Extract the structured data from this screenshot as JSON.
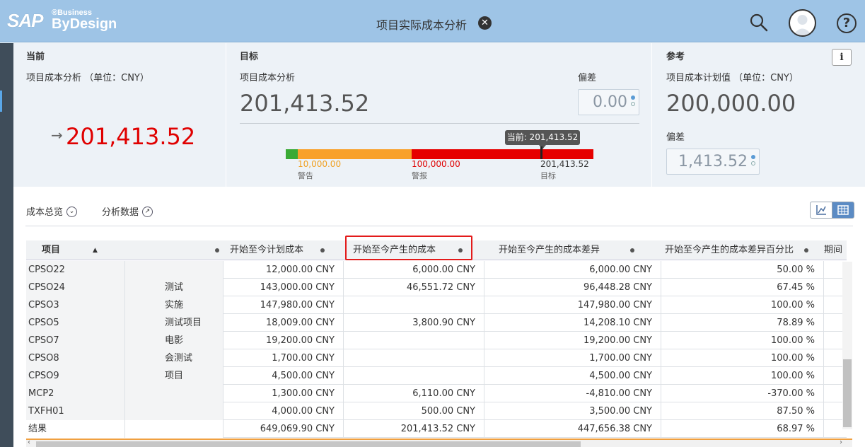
{
  "header": {
    "logo_sap": "SAP",
    "logo_business": "®Business",
    "logo_bydesign": "ByDesign",
    "title": "项目实际成本分析"
  },
  "current": {
    "section": "当前",
    "label": "项目成本分析 （单位：CNY）",
    "value": "201,413.52"
  },
  "target": {
    "section": "目标",
    "label": "项目成本分析",
    "value": "201,413.52",
    "deviation_label": "偏差",
    "deviation_value": "0.00",
    "tooltip": "当前: 201,413.52",
    "ticks": [
      {
        "value": "10,000.00",
        "label": "警告",
        "color": "#f0a020"
      },
      {
        "value": "100,000.00",
        "label": "警报",
        "color": "#e00000"
      },
      {
        "value": "201,413.52",
        "label": "目标",
        "color": "#333333"
      }
    ],
    "bar_colors": {
      "ok": "#3aaa35",
      "warn": "#f8a12a",
      "alert": "#e60000"
    }
  },
  "reference": {
    "section": "参考",
    "label": "项目成本计划值 （单位：CNY）",
    "value": "200,000.00",
    "deviation_label": "偏差",
    "deviation_value": "1,413.52"
  },
  "tabs": {
    "overview": "成本总览",
    "analysis": "分析数据"
  },
  "table": {
    "headers": [
      "项目",
      "开始至今计划成本",
      "开始至今产生的成本",
      "开始至今产生的成本差异",
      "开始至今产生的成本差异百分比",
      "期间"
    ],
    "rows": [
      {
        "id": "CPSO22",
        "name": "",
        "plan": "12,000.00 CNY",
        "actual": "6,000.00 CNY",
        "diff": "6,000.00 CNY",
        "pct": "50.00 %"
      },
      {
        "id": "CPSO24",
        "name": "测试",
        "plan": "143,000.00 CNY",
        "actual": "46,551.72 CNY",
        "diff": "96,448.28 CNY",
        "pct": "67.45 %"
      },
      {
        "id": "CPSO3",
        "name": "实施",
        "plan": "147,980.00 CNY",
        "actual": "",
        "diff": "147,980.00 CNY",
        "pct": "100.00 %"
      },
      {
        "id": "CPSO5",
        "name": "测试项目",
        "plan": "18,009.00 CNY",
        "actual": "3,800.90 CNY",
        "diff": "14,208.10 CNY",
        "pct": "78.89 %"
      },
      {
        "id": "CPSO7",
        "name": "电影",
        "plan": "19,200.00 CNY",
        "actual": "",
        "diff": "19,200.00 CNY",
        "pct": "100.00 %"
      },
      {
        "id": "CPSO8",
        "name": "会测试",
        "plan": "1,700.00 CNY",
        "actual": "",
        "diff": "1,700.00 CNY",
        "pct": "100.00 %"
      },
      {
        "id": "CPSO9",
        "name": "项目",
        "plan": "4,500.00 CNY",
        "actual": "",
        "diff": "4,500.00 CNY",
        "pct": "100.00 %"
      },
      {
        "id": "MCP2",
        "name": "",
        "plan": "1,300.00 CNY",
        "actual": "6,110.00 CNY",
        "diff": "-4,810.00 CNY",
        "pct": "-370.00 %"
      },
      {
        "id": "TXFH01",
        "name": "",
        "plan": "4,000.00 CNY",
        "actual": "500.00 CNY",
        "diff": "3,500.00 CNY",
        "pct": "87.50 %"
      }
    ],
    "total": {
      "id": "结果",
      "plan": "649,069.90 CNY",
      "actual": "201,413.52 CNY",
      "diff": "447,656.38 CNY",
      "pct": "68.97 %"
    }
  }
}
